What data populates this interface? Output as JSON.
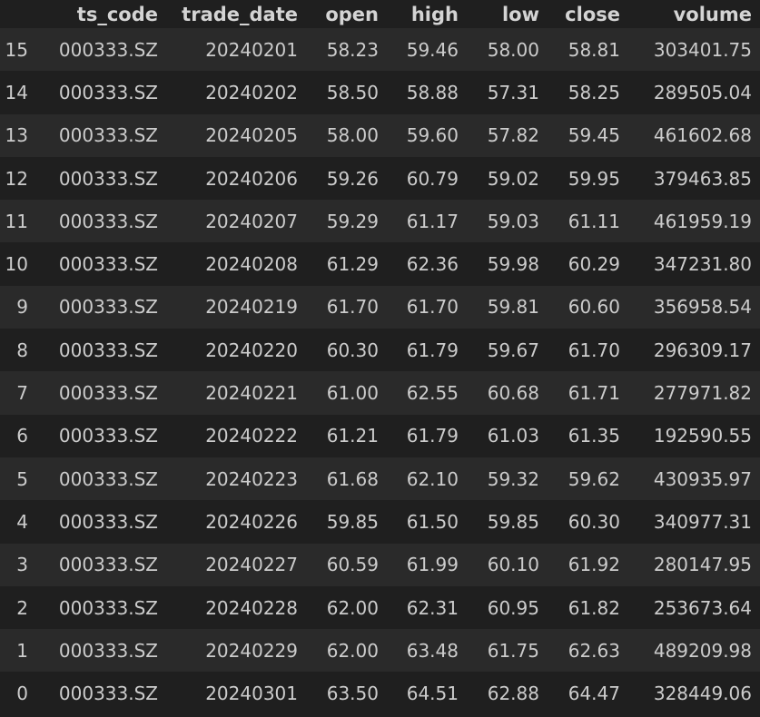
{
  "table": {
    "columns": [
      "ts_code",
      "trade_date",
      "open",
      "high",
      "low",
      "close",
      "volume"
    ],
    "rows": [
      {
        "index": "15",
        "ts_code": "000333.SZ",
        "trade_date": "20240201",
        "open": "58.23",
        "high": "59.46",
        "low": "58.00",
        "close": "58.81",
        "volume": "303401.75"
      },
      {
        "index": "14",
        "ts_code": "000333.SZ",
        "trade_date": "20240202",
        "open": "58.50",
        "high": "58.88",
        "low": "57.31",
        "close": "58.25",
        "volume": "289505.04"
      },
      {
        "index": "13",
        "ts_code": "000333.SZ",
        "trade_date": "20240205",
        "open": "58.00",
        "high": "59.60",
        "low": "57.82",
        "close": "59.45",
        "volume": "461602.68"
      },
      {
        "index": "12",
        "ts_code": "000333.SZ",
        "trade_date": "20240206",
        "open": "59.26",
        "high": "60.79",
        "low": "59.02",
        "close": "59.95",
        "volume": "379463.85"
      },
      {
        "index": "11",
        "ts_code": "000333.SZ",
        "trade_date": "20240207",
        "open": "59.29",
        "high": "61.17",
        "low": "59.03",
        "close": "61.11",
        "volume": "461959.19"
      },
      {
        "index": "10",
        "ts_code": "000333.SZ",
        "trade_date": "20240208",
        "open": "61.29",
        "high": "62.36",
        "low": "59.98",
        "close": "60.29",
        "volume": "347231.80"
      },
      {
        "index": "9",
        "ts_code": "000333.SZ",
        "trade_date": "20240219",
        "open": "61.70",
        "high": "61.70",
        "low": "59.81",
        "close": "60.60",
        "volume": "356958.54"
      },
      {
        "index": "8",
        "ts_code": "000333.SZ",
        "trade_date": "20240220",
        "open": "60.30",
        "high": "61.79",
        "low": "59.67",
        "close": "61.70",
        "volume": "296309.17"
      },
      {
        "index": "7",
        "ts_code": "000333.SZ",
        "trade_date": "20240221",
        "open": "61.00",
        "high": "62.55",
        "low": "60.68",
        "close": "61.71",
        "volume": "277971.82"
      },
      {
        "index": "6",
        "ts_code": "000333.SZ",
        "trade_date": "20240222",
        "open": "61.21",
        "high": "61.79",
        "low": "61.03",
        "close": "61.35",
        "volume": "192590.55"
      },
      {
        "index": "5",
        "ts_code": "000333.SZ",
        "trade_date": "20240223",
        "open": "61.68",
        "high": "62.10",
        "low": "59.32",
        "close": "59.62",
        "volume": "430935.97"
      },
      {
        "index": "4",
        "ts_code": "000333.SZ",
        "trade_date": "20240226",
        "open": "59.85",
        "high": "61.50",
        "low": "59.85",
        "close": "60.30",
        "volume": "340977.31"
      },
      {
        "index": "3",
        "ts_code": "000333.SZ",
        "trade_date": "20240227",
        "open": "60.59",
        "high": "61.99",
        "low": "60.10",
        "close": "61.92",
        "volume": "280147.95"
      },
      {
        "index": "2",
        "ts_code": "000333.SZ",
        "trade_date": "20240228",
        "open": "62.00",
        "high": "62.31",
        "low": "60.95",
        "close": "61.82",
        "volume": "253673.64"
      },
      {
        "index": "1",
        "ts_code": "000333.SZ",
        "trade_date": "20240229",
        "open": "62.00",
        "high": "63.48",
        "low": "61.75",
        "close": "62.63",
        "volume": "489209.98"
      },
      {
        "index": "0",
        "ts_code": "000333.SZ",
        "trade_date": "20240301",
        "open": "63.50",
        "high": "64.51",
        "low": "62.88",
        "close": "64.47",
        "volume": "328449.06"
      }
    ]
  },
  "colors": {
    "background": "#1f1f1f",
    "stripe": "#2a2a2a",
    "text": "#cccccc"
  }
}
